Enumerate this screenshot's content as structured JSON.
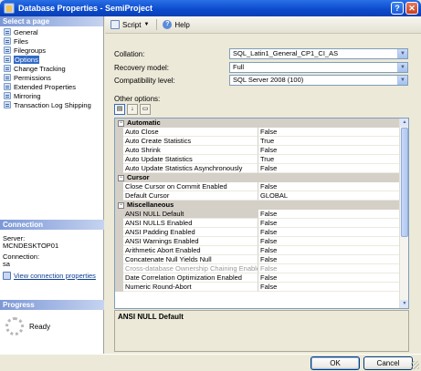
{
  "window": {
    "title": "Database Properties - SemiProject"
  },
  "left": {
    "select_header": "Select a page",
    "pages": [
      "General",
      "Files",
      "Filegroups",
      "Options",
      "Change Tracking",
      "Permissions",
      "Extended Properties",
      "Mirroring",
      "Transaction Log Shipping"
    ],
    "connection_header": "Connection",
    "server_label": "Server:",
    "server_value": "MCNDESKTOP01",
    "connection_label": "Connection:",
    "connection_value": "sa",
    "view_link": "View connection properties",
    "progress_header": "Progress",
    "progress_status": "Ready"
  },
  "toolbar": {
    "script_label": "Script",
    "help_label": "Help"
  },
  "form": {
    "collation_label": "Collation:",
    "collation_value": "SQL_Latin1_General_CP1_CI_AS",
    "recovery_label": "Recovery model:",
    "recovery_value": "Full",
    "compat_label": "Compatibility level:",
    "compat_value": "SQL Server 2008 (100)",
    "other_options_label": "Other options:"
  },
  "grid": {
    "categories": [
      {
        "name": "Automatic",
        "rows": [
          {
            "name": "Auto Close",
            "value": "False"
          },
          {
            "name": "Auto Create Statistics",
            "value": "True"
          },
          {
            "name": "Auto Shrink",
            "value": "False"
          },
          {
            "name": "Auto Update Statistics",
            "value": "True"
          },
          {
            "name": "Auto Update Statistics Asynchronously",
            "value": "False"
          }
        ]
      },
      {
        "name": "Cursor",
        "rows": [
          {
            "name": "Close Cursor on Commit Enabled",
            "value": "False"
          },
          {
            "name": "Default Cursor",
            "value": "GLOBAL"
          }
        ]
      },
      {
        "name": "Miscellaneous",
        "rows": [
          {
            "name": "ANSI NULL Default",
            "value": "False"
          },
          {
            "name": "ANSI NULLS Enabled",
            "value": "False"
          },
          {
            "name": "ANSI Padding Enabled",
            "value": "False"
          },
          {
            "name": "ANSI Warnings Enabled",
            "value": "False"
          },
          {
            "name": "Arithmetic Abort Enabled",
            "value": "False"
          },
          {
            "name": "Concatenate Null Yields Null",
            "value": "False"
          },
          {
            "name": "Cross-database Ownership Chaining Enabled",
            "value": "False"
          },
          {
            "name": "Date Correlation Optimization Enabled",
            "value": "False"
          },
          {
            "name": "Numeric Round-Abort",
            "value": "False"
          }
        ]
      }
    ],
    "description_title": "ANSI NULL Default"
  },
  "buttons": {
    "ok": "OK",
    "cancel": "Cancel"
  }
}
